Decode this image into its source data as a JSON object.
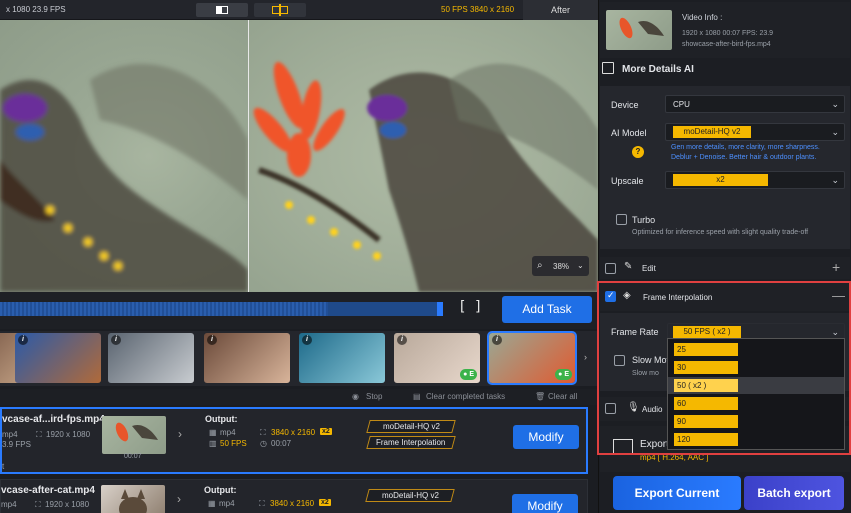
{
  "topbar": {
    "source_info": "x 1080  23.9 FPS",
    "target_fps": "50 FPS",
    "target_res": "3840 x 2160",
    "after_label": "After"
  },
  "preview": {
    "zoom": "38%"
  },
  "progress": {
    "fraction": 0.74,
    "add_task_label": "Add Task"
  },
  "thumbnails": [
    {
      "colors": [
        "#6b4a3a",
        "#c9a88a"
      ]
    },
    {
      "colors": [
        "#2b5aa8",
        "#b06a3a"
      ]
    },
    {
      "colors": [
        "#5a6470",
        "#c8ccd0"
      ]
    },
    {
      "colors": [
        "#6b4a3a",
        "#d8b49a"
      ]
    },
    {
      "colors": [
        "#1e6a8a",
        "#8ac8d8"
      ]
    },
    {
      "colors": [
        "#b8a89a",
        "#e8d8cc"
      ],
      "badge": "E"
    },
    {
      "colors": [
        "#9aa894",
        "#e05a30"
      ],
      "badge": "E",
      "selected": true
    }
  ],
  "taskbar": {
    "stop": "Stop",
    "clear_completed": "Clear completed tasks",
    "clear_all": "Clear all"
  },
  "tasks": [
    {
      "filename": "vcase-af...ird-fps.mp4",
      "src_format": "mp4",
      "src_res": "1920 x 1080",
      "src_fps": "3.9 FPS",
      "thumb_time": "00:07",
      "output_label": "Output:",
      "out_format": "mp4",
      "out_res": "3840 x 2160",
      "out_scale": "x2",
      "out_fps": "50 FPS",
      "out_duration": "00:07",
      "tag1": "moDetail-HQ  v2",
      "tag2": "Frame Interpolation",
      "modify": "Modify",
      "footer": "t"
    },
    {
      "filename": "vcase-after-cat.mp4",
      "src_format": "mp4",
      "src_res": "1920 x 1080",
      "output_label": "Output:",
      "out_format": "mp4",
      "out_res": "3840 x 2160",
      "out_scale": "x2",
      "tag1": "moDetail-HQ  v2",
      "modify": "Modify"
    }
  ],
  "video_info": {
    "title": "Video Info :",
    "res_fps": "1920 x 1080  00:07  FPS: 23.9",
    "filename": "showcase-after-bird-fps.mp4"
  },
  "more_details": {
    "title": "More Details AI",
    "device_label": "Device",
    "device_value": "CPU",
    "model_label": "AI Model",
    "model_value": "moDetail-HQ  v2",
    "model_note_1": "Gen more details, more clarity, more sharpness.",
    "model_note_2": "Deblur + Denoise. Better hair & outdoor plants.",
    "upscale_label": "Upscale",
    "upscale_value": "x2",
    "turbo_label": "Turbo",
    "turbo_note": "Optimized for inference speed with slight quality trade-off"
  },
  "edit": {
    "label": "Edit"
  },
  "frame_interp": {
    "title": "Frame Interpolation",
    "rate_label": "Frame Rate",
    "rate_value": "50 FPS ( x2 )",
    "slow_label": "Slow Mot",
    "slow_note": "Slow mo",
    "options": [
      "25",
      "30",
      "50 ( x2 )",
      "60",
      "90",
      "120"
    ],
    "selected_index": 2
  },
  "audio": {
    "label": "Audio"
  },
  "export": {
    "label": "Export",
    "format": "mp4 [ H.264, AAC ]",
    "export_current": "Export Current",
    "batch_export": "Batch export"
  }
}
